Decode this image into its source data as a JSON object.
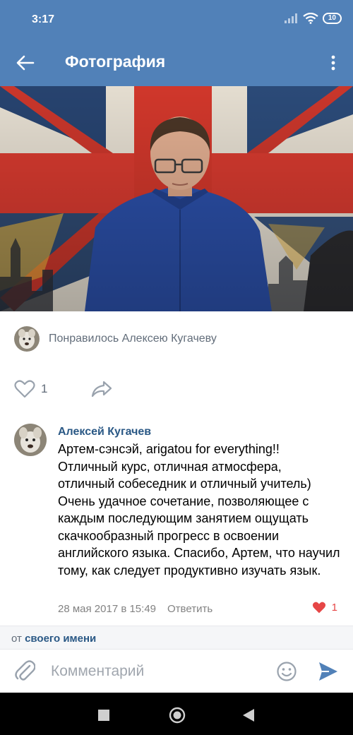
{
  "status_bar": {
    "time": "3:17",
    "battery": "10"
  },
  "app_bar": {
    "title": "Фотография"
  },
  "likes": {
    "liked_by": "Понравилось Алексею Кугачеву",
    "count": "1"
  },
  "comment": {
    "author": "Алексей Кугачев",
    "text": "Артем-сэнсэй, arigatou for everything!! Отличный курс, отличная атмосфера, отличный собеседник и отличный учитель) Очень удачное сочетание, позволяющее с каждым последующим занятием ощущать скачкообразный прогресс в освоении английского языка. Спасибо, Артем, что научил тому, как следует продуктивно изучать язык.",
    "date": "28 мая 2017 в 15:49",
    "reply_label": "Ответить",
    "like_count": "1"
  },
  "composer": {
    "from_prefix": "от ",
    "from_link": "своего имени",
    "placeholder": "Комментарий"
  },
  "colors": {
    "header": "#5181b8",
    "link": "#2a5885",
    "accent": "#5181b8",
    "heart": "#e64646"
  },
  "icons": [
    "back-arrow-icon",
    "more-vertical-icon",
    "heart-outline-icon",
    "share-icon",
    "heart-filled-icon",
    "paperclip-icon",
    "emoji-icon",
    "send-icon",
    "stop-icon",
    "home-circle-icon",
    "back-triangle-icon"
  ]
}
